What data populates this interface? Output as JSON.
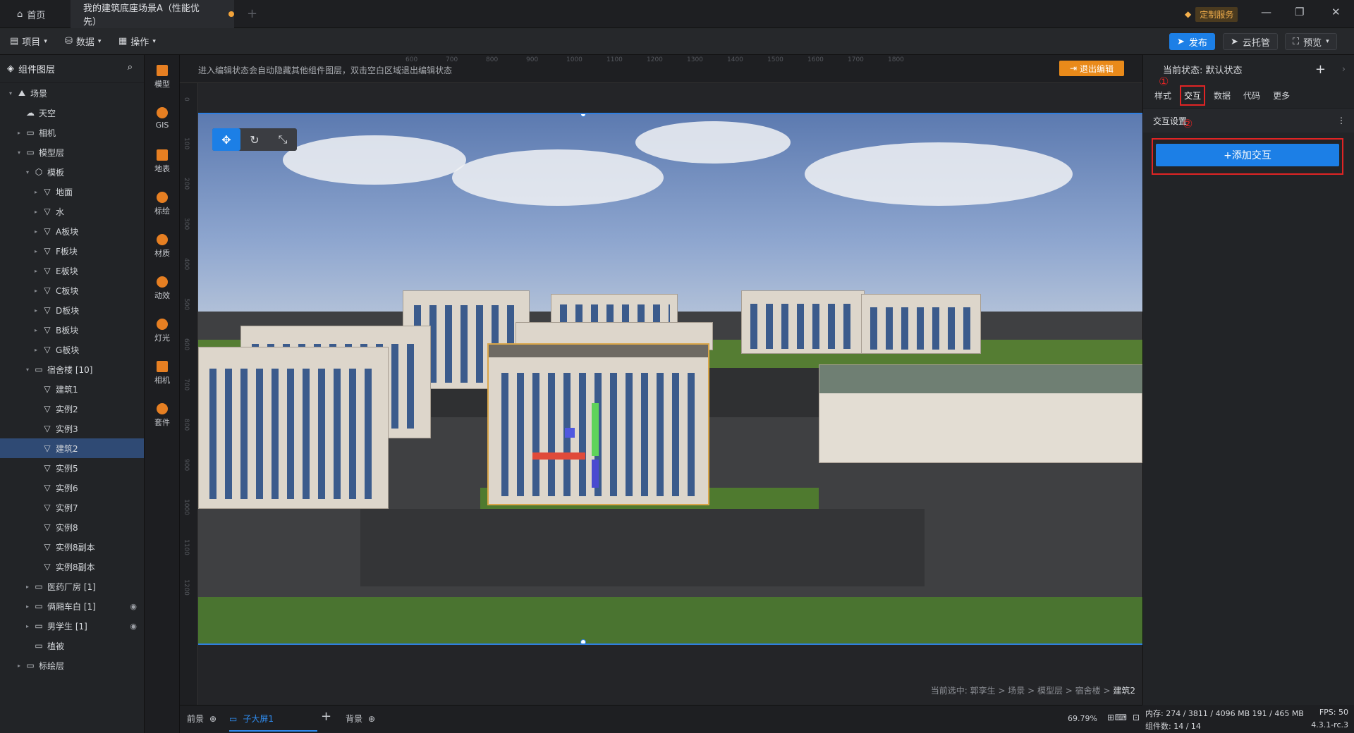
{
  "tabs": {
    "home": "首页",
    "document": "我的建筑底座场景A（性能优先）",
    "custom_service": "定制服务"
  },
  "toolbar": {
    "menus": [
      "项目",
      "数据",
      "操作"
    ],
    "publish": "发布",
    "cloud_host": "云托管",
    "preview": "预览"
  },
  "left_panel": {
    "title": "组件图层",
    "tree": [
      {
        "label": "场景",
        "depth": 0,
        "caret": "▾",
        "icon": "⛰"
      },
      {
        "label": "天空",
        "depth": 1,
        "caret": "",
        "icon": "☁"
      },
      {
        "label": "相机",
        "depth": 1,
        "caret": "▸",
        "icon": "▭"
      },
      {
        "label": "模型层",
        "depth": 1,
        "caret": "▾",
        "icon": "▭"
      },
      {
        "label": "模板",
        "depth": 2,
        "caret": "▾",
        "icon": "⬡"
      },
      {
        "label": "地面",
        "depth": 3,
        "caret": "▸",
        "icon": "▽"
      },
      {
        "label": "水",
        "depth": 3,
        "caret": "▸",
        "icon": "▽"
      },
      {
        "label": "A板块",
        "depth": 3,
        "caret": "▸",
        "icon": "▽"
      },
      {
        "label": "F板块",
        "depth": 3,
        "caret": "▸",
        "icon": "▽"
      },
      {
        "label": "E板块",
        "depth": 3,
        "caret": "▸",
        "icon": "▽"
      },
      {
        "label": "C板块",
        "depth": 3,
        "caret": "▸",
        "icon": "▽"
      },
      {
        "label": "D板块",
        "depth": 3,
        "caret": "▸",
        "icon": "▽"
      },
      {
        "label": "B板块",
        "depth": 3,
        "caret": "▸",
        "icon": "▽"
      },
      {
        "label": "G板块",
        "depth": 3,
        "caret": "▸",
        "icon": "▽"
      },
      {
        "label": "宿舍楼 [10]",
        "depth": 2,
        "caret": "▾",
        "icon": "▭"
      },
      {
        "label": "建筑1",
        "depth": 3,
        "caret": "",
        "icon": "▽"
      },
      {
        "label": "实例2",
        "depth": 3,
        "caret": "",
        "icon": "▽"
      },
      {
        "label": "实例3",
        "depth": 3,
        "caret": "",
        "icon": "▽"
      },
      {
        "label": "建筑2",
        "depth": 3,
        "caret": "",
        "icon": "▽",
        "selected": true
      },
      {
        "label": "实例5",
        "depth": 3,
        "caret": "",
        "icon": "▽"
      },
      {
        "label": "实例6",
        "depth": 3,
        "caret": "",
        "icon": "▽"
      },
      {
        "label": "实例7",
        "depth": 3,
        "caret": "",
        "icon": "▽"
      },
      {
        "label": "实例8",
        "depth": 3,
        "caret": "",
        "icon": "▽"
      },
      {
        "label": "实例8副本",
        "depth": 3,
        "caret": "",
        "icon": "▽"
      },
      {
        "label": "实例8副本",
        "depth": 3,
        "caret": "",
        "icon": "▽"
      },
      {
        "label": "医药厂房 [1]",
        "depth": 2,
        "caret": "▸",
        "icon": "▭"
      },
      {
        "label": "俩厢车白 [1]",
        "depth": 2,
        "caret": "▸",
        "icon": "▭",
        "hidden": true
      },
      {
        "label": "男学生 [1]",
        "depth": 2,
        "caret": "▸",
        "icon": "▭",
        "hidden": true
      },
      {
        "label": "植被",
        "depth": 2,
        "caret": "",
        "icon": "▭"
      },
      {
        "label": "标绘层",
        "depth": 1,
        "caret": "▸",
        "icon": "▭"
      }
    ]
  },
  "icon_bar": [
    "模型",
    "GIS",
    "地表",
    "标绘",
    "材质",
    "动效",
    "灯光",
    "相机",
    "套件"
  ],
  "canvas": {
    "hint": "进入编辑状态会自动隐藏其他组件图层，双击空白区域退出编辑状态",
    "exit_edit": "退出编辑",
    "ruler_top": [
      "600",
      "700",
      "800",
      "900",
      "1000",
      "1100",
      "1200",
      "1300",
      "1400",
      "1500",
      "1600",
      "1700",
      "1800"
    ],
    "ruler_left": [
      "0",
      "100",
      "200",
      "300",
      "400",
      "500",
      "600",
      "700",
      "800",
      "900",
      "1000",
      "1100",
      "1200"
    ],
    "breadcrumb_prefix": "当前选中: 郭孪生 > 场景 > 模型层 > 宿舍楼 > ",
    "breadcrumb_current": "建筑2"
  },
  "bottom_bar": {
    "foreground": "前景",
    "sub_screen": "子大屏1",
    "background": "背景",
    "zoom": "69.79%"
  },
  "right_panel": {
    "state_label": "当前状态:",
    "state_value": "默认状态",
    "tabs": [
      "样式",
      "交互",
      "数据",
      "代码",
      "更多"
    ],
    "active_tab": "交互",
    "badge1": "①",
    "badge2": "②",
    "section": "交互设置",
    "add_button": "+添加交互"
  },
  "status": {
    "memory_label": "内存:",
    "memory": "274 / 3811 / 4096 MB  191 / 465 MB",
    "fps_label": "FPS:",
    "fps": "50",
    "components_label": "组件数:",
    "components": "14 / 14",
    "version": "4.3.1-rc.3"
  }
}
